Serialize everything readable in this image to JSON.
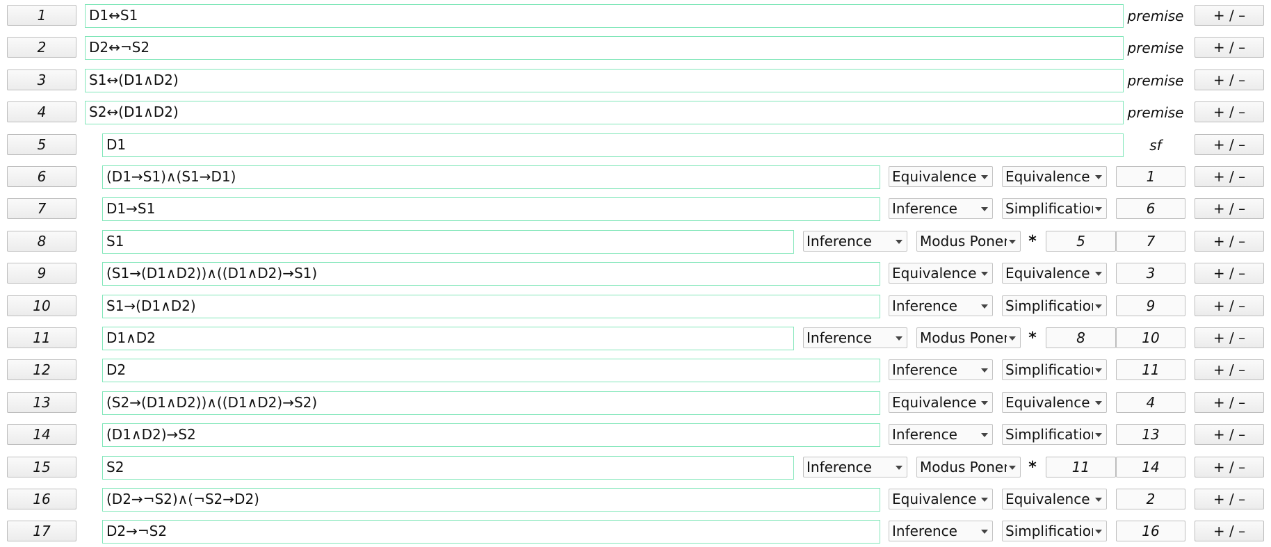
{
  "add_remove_label": "+ / –",
  "rows": [
    {
      "num": "1",
      "formula": "D1↔S1",
      "kind": "premise",
      "justification": "premise"
    },
    {
      "num": "2",
      "formula": "D2↔¬S2",
      "kind": "premise",
      "justification": "premise"
    },
    {
      "num": "3",
      "formula": "S1↔(D1∧D2)",
      "kind": "premise",
      "justification": "premise"
    },
    {
      "num": "4",
      "formula": "S2↔(D1∧D2)",
      "kind": "premise",
      "justification": "premise"
    },
    {
      "num": "5",
      "formula": "D1",
      "kind": "sf",
      "justification": "sf"
    },
    {
      "num": "6",
      "formula": "(D1→S1)∧(S1→D1)",
      "kind": "one",
      "rule_type": "Equivalence",
      "rule": "Equivalence",
      "cites": [
        "1"
      ]
    },
    {
      "num": "7",
      "formula": "D1→S1",
      "kind": "one",
      "rule_type": "Inference",
      "rule": "Simplification",
      "cites": [
        "6"
      ]
    },
    {
      "num": "8",
      "formula": "S1",
      "kind": "two",
      "rule_type": "Inference",
      "rule": "Modus Ponens",
      "star": "*",
      "cites": [
        "5",
        "7"
      ]
    },
    {
      "num": "9",
      "formula": "(S1→(D1∧D2))∧((D1∧D2)→S1)",
      "kind": "one",
      "rule_type": "Equivalence",
      "rule": "Equivalence",
      "cites": [
        "3"
      ]
    },
    {
      "num": "10",
      "formula": "S1→(D1∧D2)",
      "kind": "one",
      "rule_type": "Inference",
      "rule": "Simplification",
      "cites": [
        "9"
      ]
    },
    {
      "num": "11",
      "formula": "D1∧D2",
      "kind": "two",
      "rule_type": "Inference",
      "rule": "Modus Ponens",
      "star": "*",
      "cites": [
        "8",
        "10"
      ]
    },
    {
      "num": "12",
      "formula": "D2",
      "kind": "one",
      "rule_type": "Inference",
      "rule": "Simplification",
      "cites": [
        "11"
      ]
    },
    {
      "num": "13",
      "formula": "(S2→(D1∧D2))∧((D1∧D2)→S2)",
      "kind": "one",
      "rule_type": "Equivalence",
      "rule": "Equivalence",
      "cites": [
        "4"
      ]
    },
    {
      "num": "14",
      "formula": "(D1∧D2)→S2",
      "kind": "one",
      "rule_type": "Inference",
      "rule": "Simplification",
      "cites": [
        "13"
      ]
    },
    {
      "num": "15",
      "formula": "S2",
      "kind": "two",
      "rule_type": "Inference",
      "rule": "Modus Ponens",
      "star": "*",
      "cites": [
        "11",
        "14"
      ]
    },
    {
      "num": "16",
      "formula": "(D2→¬S2)∧(¬S2→D2)",
      "kind": "one",
      "rule_type": "Equivalence",
      "rule": "Equivalence",
      "cites": [
        "2"
      ]
    },
    {
      "num": "17",
      "formula": "D2→¬S2",
      "kind": "one",
      "rule_type": "Inference",
      "rule": "Simplification",
      "cites": [
        "16"
      ]
    }
  ]
}
